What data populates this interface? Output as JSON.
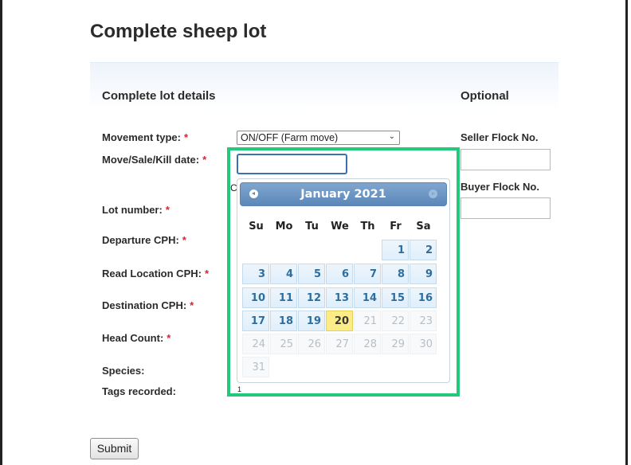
{
  "page": {
    "title": "Complete sheep lot"
  },
  "sections": {
    "details_title": "Complete lot details",
    "optional_title": "Optional"
  },
  "form": {
    "required_marker": "*",
    "movement_type": {
      "label": "Movement type:",
      "value": "ON/OFF (Farm move)"
    },
    "move_date": {
      "label": "Move/Sale/Kill date:",
      "value": ""
    },
    "lot_number": {
      "label": "Lot number:"
    },
    "departure_cph": {
      "label": "Departure CPH:"
    },
    "read_location_cph": {
      "label": "Read Location CPH:"
    },
    "destination_cph": {
      "label": "Destination CPH:"
    },
    "head_count": {
      "label": "Head Count:"
    },
    "species": {
      "label": "Species:"
    },
    "tags_recorded": {
      "label": "Tags recorded:",
      "value": "1"
    },
    "peek_char": "C"
  },
  "optional": {
    "seller_flock": {
      "label": "Seller Flock No.",
      "value": ""
    },
    "buyer_flock": {
      "label": "Buyer Flock No.",
      "value": ""
    }
  },
  "datepicker": {
    "month_year": "January 2021",
    "weekdays": [
      "Su",
      "Mo",
      "Tu",
      "We",
      "Th",
      "Fr",
      "Sa"
    ],
    "today": 20,
    "weeks": [
      [
        "",
        "",
        "",
        "",
        "",
        "1",
        "2"
      ],
      [
        "3",
        "4",
        "5",
        "6",
        "7",
        "8",
        "9"
      ],
      [
        "10",
        "11",
        "12",
        "13",
        "14",
        "15",
        "16"
      ],
      [
        "17",
        "18",
        "19",
        "20",
        "21",
        "22",
        "23"
      ],
      [
        "24",
        "25",
        "26",
        "27",
        "28",
        "29",
        "30"
      ],
      [
        "31",
        "",
        "",
        "",
        "",
        "",
        ""
      ]
    ],
    "icons": {
      "prev": "prev-month-icon",
      "next": "next-month-icon"
    }
  },
  "actions": {
    "submit_label": "Submit"
  },
  "colors": {
    "highlight": "#23c97a",
    "required": "#d0282e",
    "header": "#5b87b9",
    "today": "#fbec88"
  }
}
